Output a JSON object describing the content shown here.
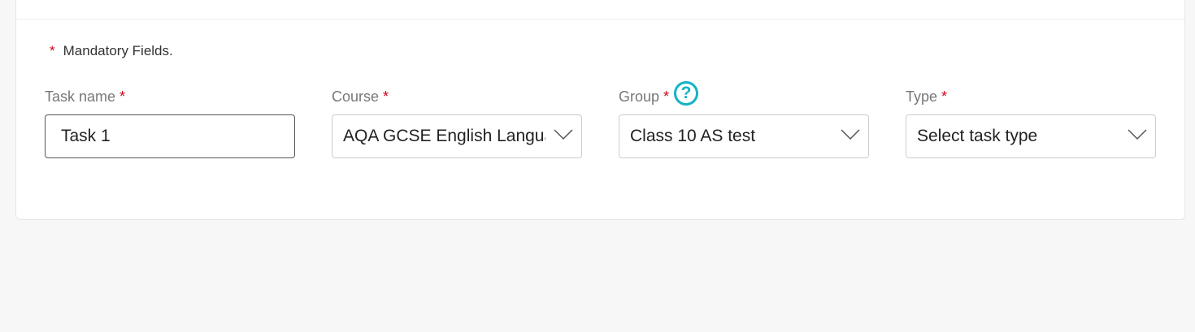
{
  "form": {
    "mandatory_star": "*",
    "mandatory_text": "Mandatory Fields.",
    "required_star": "*",
    "help_symbol": "?",
    "fields": {
      "task_name": {
        "label": "Task name",
        "value": "Task 1"
      },
      "course": {
        "label": "Course",
        "value": "AQA GCSE English Langua"
      },
      "group": {
        "label": "Group",
        "value": "Class 10 AS test"
      },
      "type": {
        "label": "Type",
        "value": "Select task type"
      }
    }
  },
  "colors": {
    "required": "#d0021b",
    "help_accent": "#13b3c4",
    "page_background": "#f7f7f7"
  },
  "icons": {
    "help": "question-circle-icon",
    "dropdown": "chevron-down-icon"
  }
}
